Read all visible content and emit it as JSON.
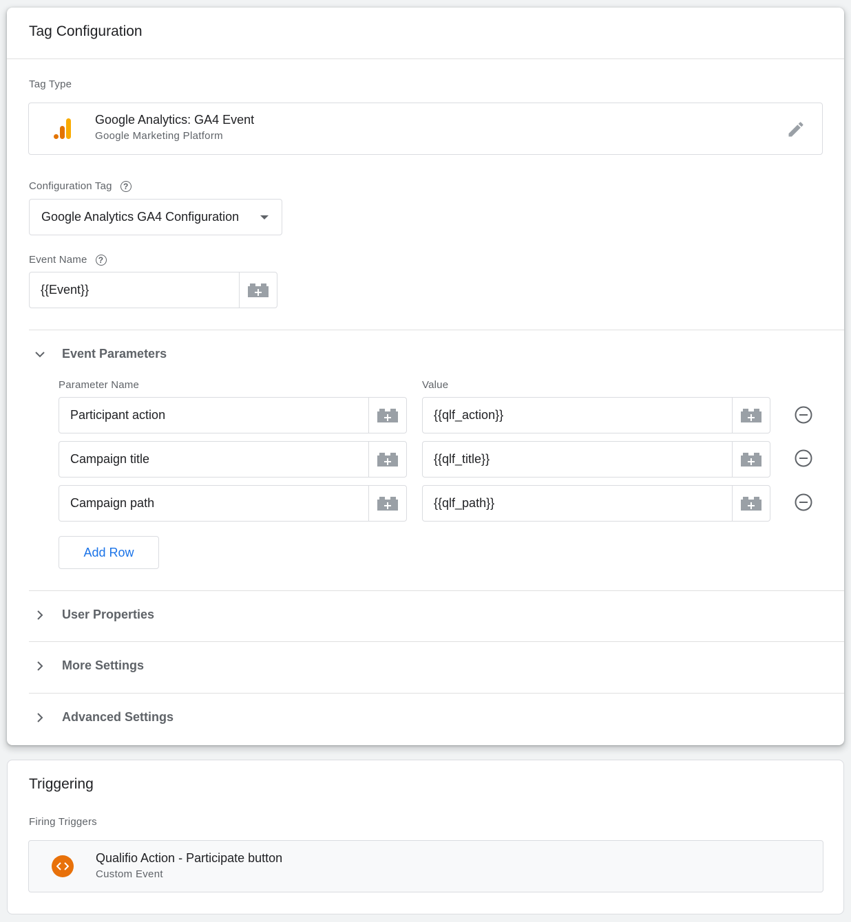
{
  "tag_config": {
    "title": "Tag Configuration",
    "tag_type_label": "Tag Type",
    "tag_type_name": "Google Analytics: GA4 Event",
    "tag_type_vendor": "Google Marketing Platform",
    "config_tag_label": "Configuration Tag",
    "config_tag_value": "Google Analytics GA4 Configuration",
    "event_name_label": "Event Name",
    "event_name_value": "{{Event}}",
    "help_glyph": "?"
  },
  "event_params": {
    "title": "Event Parameters",
    "col_name": "Parameter Name",
    "col_value": "Value",
    "rows": [
      {
        "name": "Participant action",
        "value": "{{qlf_action}}"
      },
      {
        "name": "Campaign title",
        "value": "{{qlf_title}}"
      },
      {
        "name": "Campaign path",
        "value": "{{qlf_path}}"
      }
    ],
    "add_row_label": "Add Row"
  },
  "sections": {
    "user_properties": "User Properties",
    "more_settings": "More Settings",
    "advanced_settings": "Advanced Settings"
  },
  "triggering": {
    "title": "Triggering",
    "firing_label": "Firing Triggers",
    "trigger_name": "Qualifio Action - Participate button",
    "trigger_type": "Custom Event"
  },
  "colors": {
    "accent_blue": "#1a73e8",
    "ga_orange": "#f9ab00",
    "ga_dark_orange": "#e37400",
    "trigger_orange": "#e8710a"
  }
}
